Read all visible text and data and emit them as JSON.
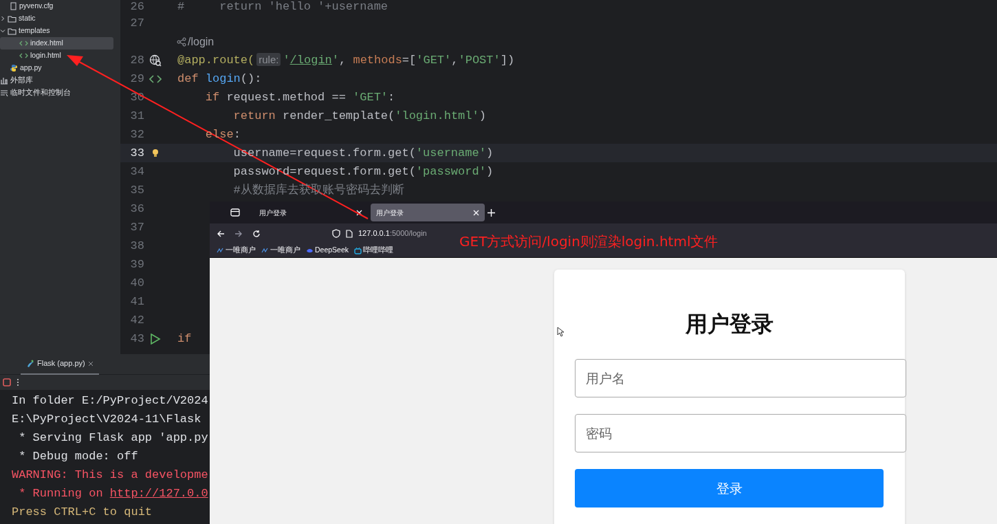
{
  "project_tree": {
    "items": [
      {
        "label": "pyvenv.cfg",
        "kind": "config",
        "selected": false
      },
      {
        "label": "static",
        "kind": "folder",
        "expanded": false,
        "selected": false
      },
      {
        "label": "templates",
        "kind": "folder",
        "expanded": true,
        "selected": false,
        "children": [
          {
            "label": "index.html",
            "kind": "html",
            "selected": true
          },
          {
            "label": "login.html",
            "kind": "html",
            "selected": false
          }
        ]
      },
      {
        "label": "app.py",
        "kind": "python",
        "selected": false
      },
      {
        "label": "外部库",
        "kind": "library",
        "selected": false
      },
      {
        "label": "临时文件和控制台",
        "kind": "scratches",
        "selected": false
      }
    ]
  },
  "editor": {
    "lines": [
      {
        "kind": "code",
        "number": "26",
        "tokens": [
          {
            "kind": "comment",
            "text": "#     return 'hello '+username"
          }
        ]
      },
      {
        "kind": "code",
        "number": "27"
      },
      {
        "kind": "inlay",
        "text": "/login"
      },
      {
        "kind": "code",
        "number": "28",
        "gutter": {
          "kind": "globe"
        },
        "tokens": [
          {
            "kind": "decorator",
            "text": "@app.route("
          },
          {
            "kind": "hint",
            "text": "rule:"
          },
          {
            "kind": "string",
            "text": "'"
          },
          {
            "kind": "url",
            "text": "/login"
          },
          {
            "kind": "string",
            "text": "'"
          },
          {
            "kind": "plain",
            "text": ", "
          },
          {
            "kind": "param",
            "text": "methods"
          },
          {
            "kind": "plain",
            "text": "=["
          },
          {
            "kind": "string",
            "text": "'GET'"
          },
          {
            "kind": "plain",
            "text": ","
          },
          {
            "kind": "string",
            "text": "'POST'"
          },
          {
            "kind": "plain",
            "text": "])"
          }
        ]
      },
      {
        "kind": "code",
        "number": "29",
        "gutter": {
          "kind": "html"
        },
        "tokens": [
          {
            "kind": "keyword",
            "text": "def "
          },
          {
            "kind": "function",
            "text": "login"
          },
          {
            "kind": "plain",
            "text": "():"
          }
        ]
      },
      {
        "kind": "code",
        "number": "30",
        "tokens": [
          {
            "kind": "keyword",
            "text": "    if"
          },
          {
            "kind": "plain",
            "text": " request.method == "
          },
          {
            "kind": "string",
            "text": "'GET'"
          },
          {
            "kind": "plain",
            "text": ":"
          }
        ]
      },
      {
        "kind": "code",
        "number": "31",
        "tokens": [
          {
            "kind": "keyword",
            "text": "        return"
          },
          {
            "kind": "plain",
            "text": " render_template("
          },
          {
            "kind": "string",
            "text": "'login.html'"
          },
          {
            "kind": "plain",
            "text": ")"
          }
        ]
      },
      {
        "kind": "code",
        "number": "32",
        "tokens": [
          {
            "kind": "keyword",
            "text": "    else"
          },
          {
            "kind": "plain",
            "text": ":"
          }
        ]
      },
      {
        "kind": "code",
        "number": "33",
        "current": true,
        "gutter": {
          "kind": "bulb"
        },
        "tokens": [
          {
            "kind": "plain",
            "text": "        username=request.form.get("
          },
          {
            "kind": "string",
            "text": "'username'"
          },
          {
            "kind": "plain",
            "text": ")"
          }
        ]
      },
      {
        "kind": "code",
        "number": "34",
        "tokens": [
          {
            "kind": "plain",
            "text": "        password=request.form.get("
          },
          {
            "kind": "string",
            "text": "'password'"
          },
          {
            "kind": "plain",
            "text": ")"
          }
        ]
      },
      {
        "kind": "code",
        "number": "35",
        "tokens": [
          {
            "kind": "comment",
            "text": "        #从数据库去获取账号密码去判断"
          }
        ]
      },
      {
        "kind": "code",
        "number": "36"
      },
      {
        "kind": "code",
        "number": "37"
      },
      {
        "kind": "code",
        "number": "38"
      },
      {
        "kind": "code",
        "number": "39"
      },
      {
        "kind": "code",
        "number": "40"
      },
      {
        "kind": "code",
        "number": "41"
      },
      {
        "kind": "code",
        "number": "42"
      },
      {
        "kind": "code",
        "number": "43",
        "gutter": {
          "kind": "run"
        },
        "tokens": [
          {
            "kind": "keyword",
            "text": "if"
          }
        ]
      }
    ]
  },
  "run_panel": {
    "tab": "Flask (app.py)",
    "lines": [
      {
        "tokens": [
          {
            "kind": "plain",
            "text": "In folder E:/PyProject/V2024"
          }
        ]
      },
      {
        "tokens": [
          {
            "kind": "plain",
            "text": "E:\\PyProject\\V2024-11\\Flask"
          }
        ]
      },
      {
        "tokens": [
          {
            "kind": "plain",
            "text": " * Serving Flask app 'app.py"
          }
        ]
      },
      {
        "tokens": [
          {
            "kind": "plain",
            "text": " * Debug mode: off"
          }
        ]
      },
      {
        "tokens": [
          {
            "kind": "error",
            "text": "WARNING: This is a developme"
          }
        ]
      },
      {
        "tokens": [
          {
            "kind": "error",
            "text": " * Running on "
          },
          {
            "kind": "link",
            "text": "http://127.0.0"
          }
        ]
      },
      {
        "tokens": [
          {
            "kind": "warn",
            "text": "Press CTRL+C to quit"
          }
        ]
      }
    ]
  },
  "browser": {
    "tabs": [
      {
        "title": "用户登录",
        "selected": false
      },
      {
        "title": "用户登录",
        "selected": true
      }
    ],
    "address": {
      "host": "127.0.0.1",
      "path": ":5000/login"
    },
    "bookmarks": [
      {
        "label": "一唯商户",
        "kind": "link"
      },
      {
        "label": "一唯商户",
        "kind": "link"
      },
      {
        "label": "DeepSeek",
        "kind": "whale"
      },
      {
        "label": "哔哩哔哩",
        "kind": "tv"
      }
    ],
    "page": {
      "title": "用户登录",
      "fields": [
        {
          "placeholder": "用户名"
        },
        {
          "placeholder": "密码"
        }
      ],
      "submit": "登录"
    }
  },
  "annotation": {
    "text": "GET方式访问/login则渲染login.html文件"
  }
}
